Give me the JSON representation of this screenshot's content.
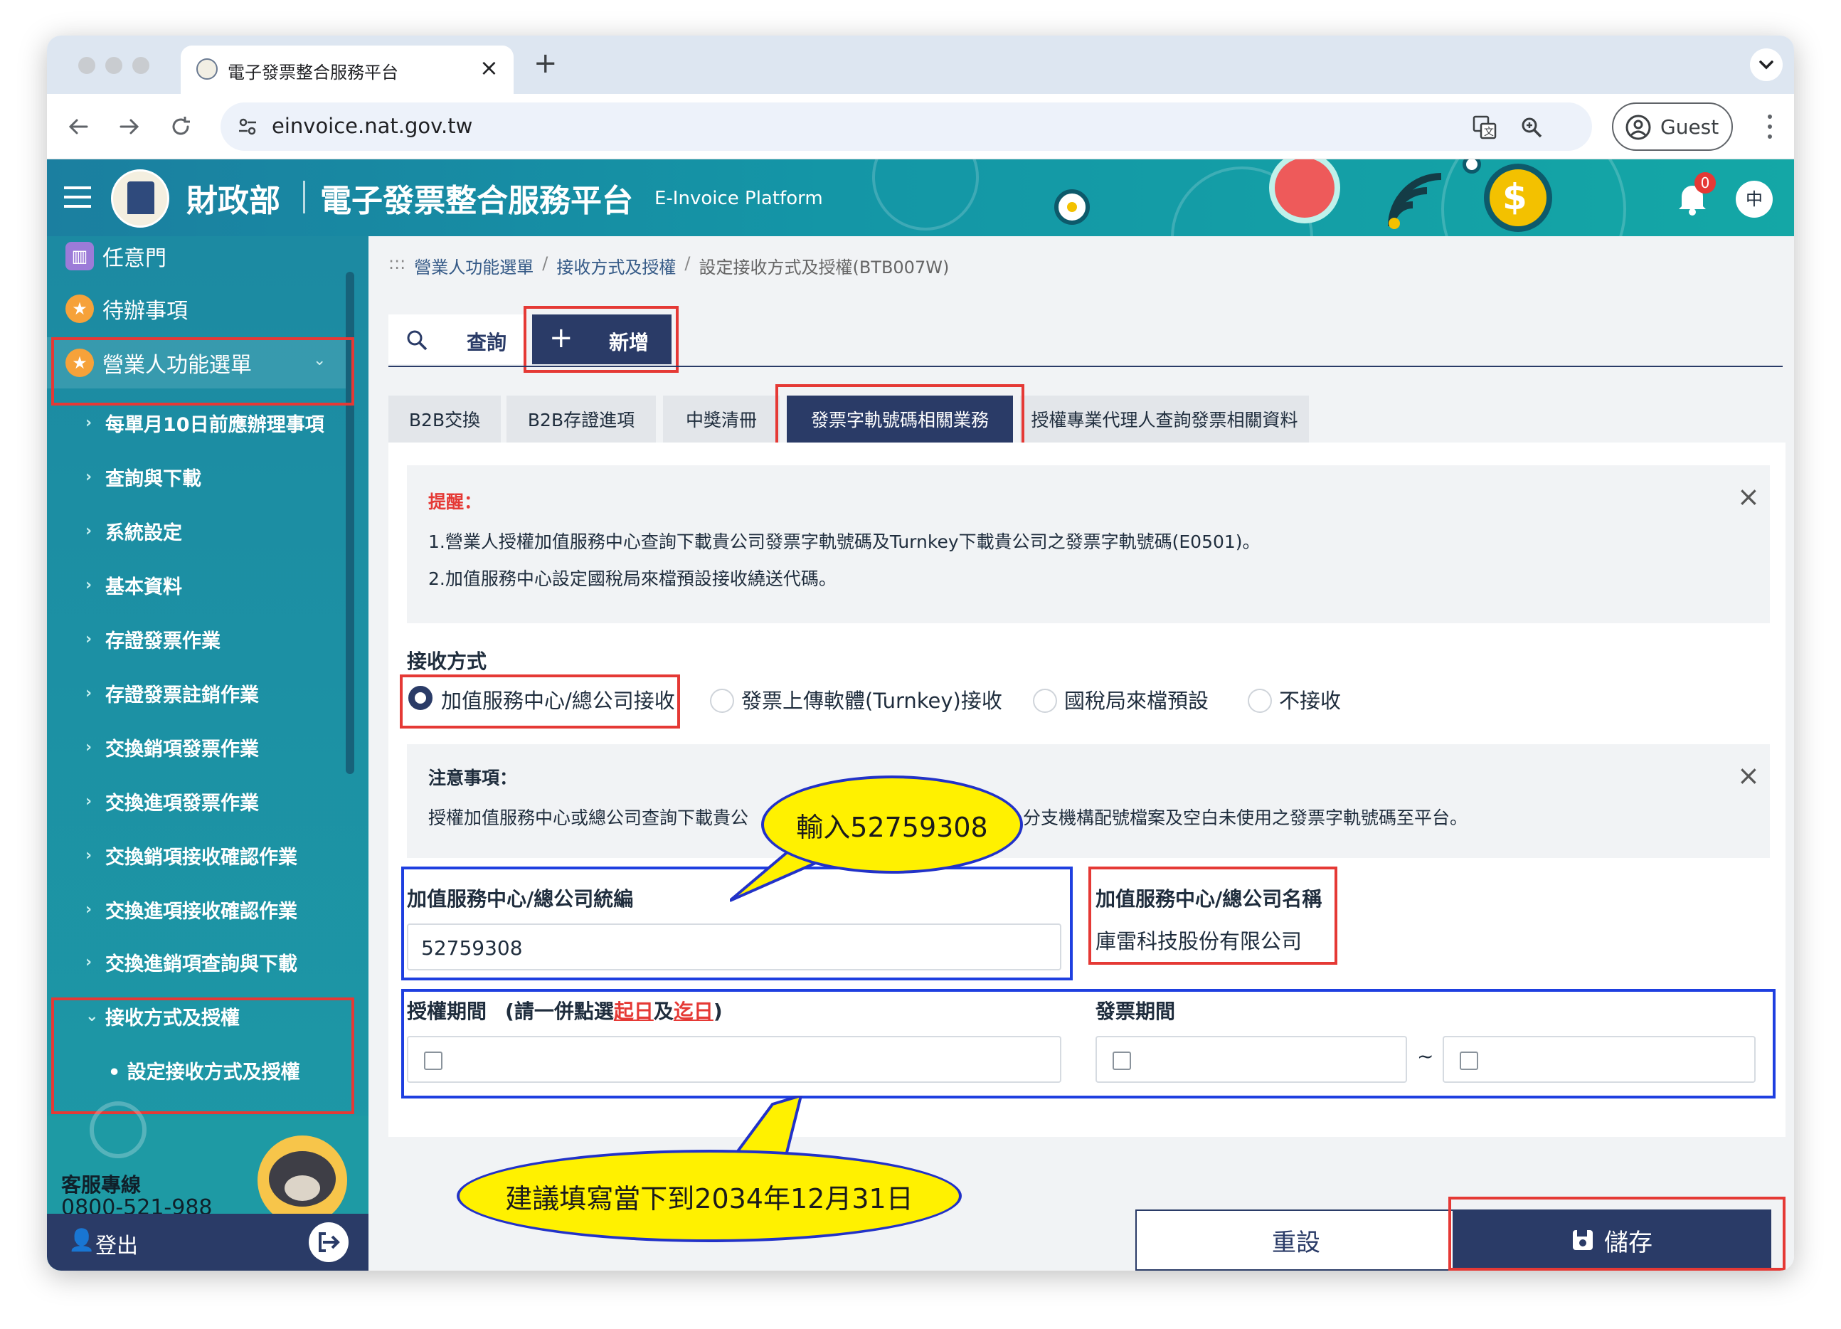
{
  "browser": {
    "tab_title": "電子發票整合服務平台",
    "tab_close": "×",
    "new_tab": "+",
    "url": "einvoice.nat.gov.tw",
    "profile_label": "Guest"
  },
  "header": {
    "ministry": "財政部",
    "platform": "電子發票整合服務平台",
    "platform_en": "E-Invoice Platform",
    "notification_count": "0",
    "lang_button": "中"
  },
  "sidebar": {
    "items": [
      {
        "label": "任意門",
        "icon": "map-icon"
      },
      {
        "label": "待辦事項",
        "icon": "star-icon"
      },
      {
        "label": "營業人功能選單",
        "icon": "star-icon"
      }
    ],
    "sub_items": [
      "每單月10日前應辦理事項",
      "查詢與下載",
      "系統設定",
      "基本資料",
      "存證發票作業",
      "存證發票註銷作業",
      "交換銷項發票作業",
      "交換進項發票作業",
      "交換銷項接收確認作業",
      "交換進項接收確認作業",
      "交換進銷項查詢與下載",
      "接收方式及授權"
    ],
    "sub_sub_item": "• 設定接收方式及授權",
    "service_label": "客服專線",
    "service_phone": "0800-521-988",
    "logout": "登出"
  },
  "breadcrumb": {
    "prefix": ":::",
    "items": [
      "營業人功能選單",
      "接收方式及授權",
      "設定接收方式及授權(BTB007W)"
    ],
    "sep": "/"
  },
  "actions": {
    "query": "查詢",
    "add": "新增"
  },
  "tabs": [
    "B2B交換",
    "B2B存證進項",
    "中獎清冊",
    "發票字軌號碼相關業務",
    "授權專業代理人查詢發票相關資料"
  ],
  "reminder": {
    "title": "提醒：",
    "line1": "1.營業人授權加值服務中心查詢下載貴公司發票字軌號碼及Turnkey下載貴公司之發票字軌號碼(E0501)。",
    "line2": "2.加值服務中心設定國稅局來檔預設接收繞送代碼。"
  },
  "receive": {
    "label": "接收方式",
    "options": [
      "加值服務中心/總公司接收",
      "發票上傳軟體(Turnkey)接收",
      "國稅局來檔預設",
      "不接收"
    ],
    "selected": 0
  },
  "note": {
    "title": "注意事項：",
    "text_left": "授權加值服務中心或總公司查詢下載貴公",
    "text_right": "分支機構配號檔案及空白未使用之發票字軌號碼至平台。"
  },
  "form": {
    "ban_label": "加值服務中心/總公司統編",
    "ban_value": "52759308",
    "name_label": "加值服務中心/總公司名稱",
    "name_value": "庫雷科技股份有限公司",
    "auth_period_label": "授權期間",
    "auth_hint_pre": "(請一併點選",
    "auth_hint_start": "起日",
    "auth_hint_and": "及",
    "auth_hint_end": "迄日",
    "auth_hint_post": ")",
    "invoice_period_label": "發票期間",
    "tilde": "~"
  },
  "callouts": {
    "enter_ban": "輸入52759308",
    "suggest_date": "建議填寫當下到2034年12月31日"
  },
  "footer_buttons": {
    "reset": "重設",
    "save": "儲存"
  },
  "colors": {
    "brand_teal": "#1496a6",
    "navy_button": "#2a3b67",
    "annotation_red": "#e53935",
    "annotation_blue": "#1e3fe0",
    "callout_yellow": "#fff100"
  }
}
